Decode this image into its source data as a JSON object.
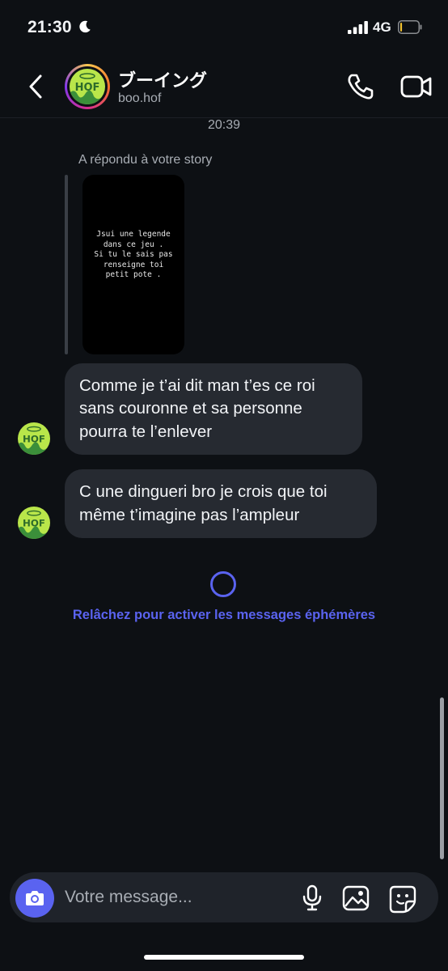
{
  "status_bar": {
    "time": "21:30",
    "network": "4G",
    "battery_level": 0.1
  },
  "header": {
    "contact_name": "ブーイング",
    "contact_handle": "boo.hof",
    "avatar_text": "HOF"
  },
  "chat": {
    "timestamp": "20:39",
    "story_reply": {
      "label": "A répondu à votre story",
      "story_text": "Jsui une legende\ndans ce jeu .\nSi tu le sais pas\nrenseigne toi\npetit pote ."
    },
    "messages": [
      {
        "text": "Comme je t’ai dit man t’es ce roi sans couronne et sa personne pourra te l’enlever"
      },
      {
        "text": "C une dingueri bro je crois que toi même t’imagine pas l’ampleur"
      }
    ],
    "vanish_mode_hint": "Relâchez pour activer les messages éphémères"
  },
  "composer": {
    "placeholder": "Votre message..."
  },
  "icons": {
    "back": "chevron-left-icon",
    "call": "phone-icon",
    "video": "video-camera-icon",
    "camera": "camera-icon",
    "mic": "microphone-icon",
    "gallery": "image-icon",
    "sticker": "sticker-icon"
  },
  "colors": {
    "background": "#0d1014",
    "bubble": "#262a31",
    "accent": "#5a63f0",
    "secondary_text": "#a8adb4"
  }
}
